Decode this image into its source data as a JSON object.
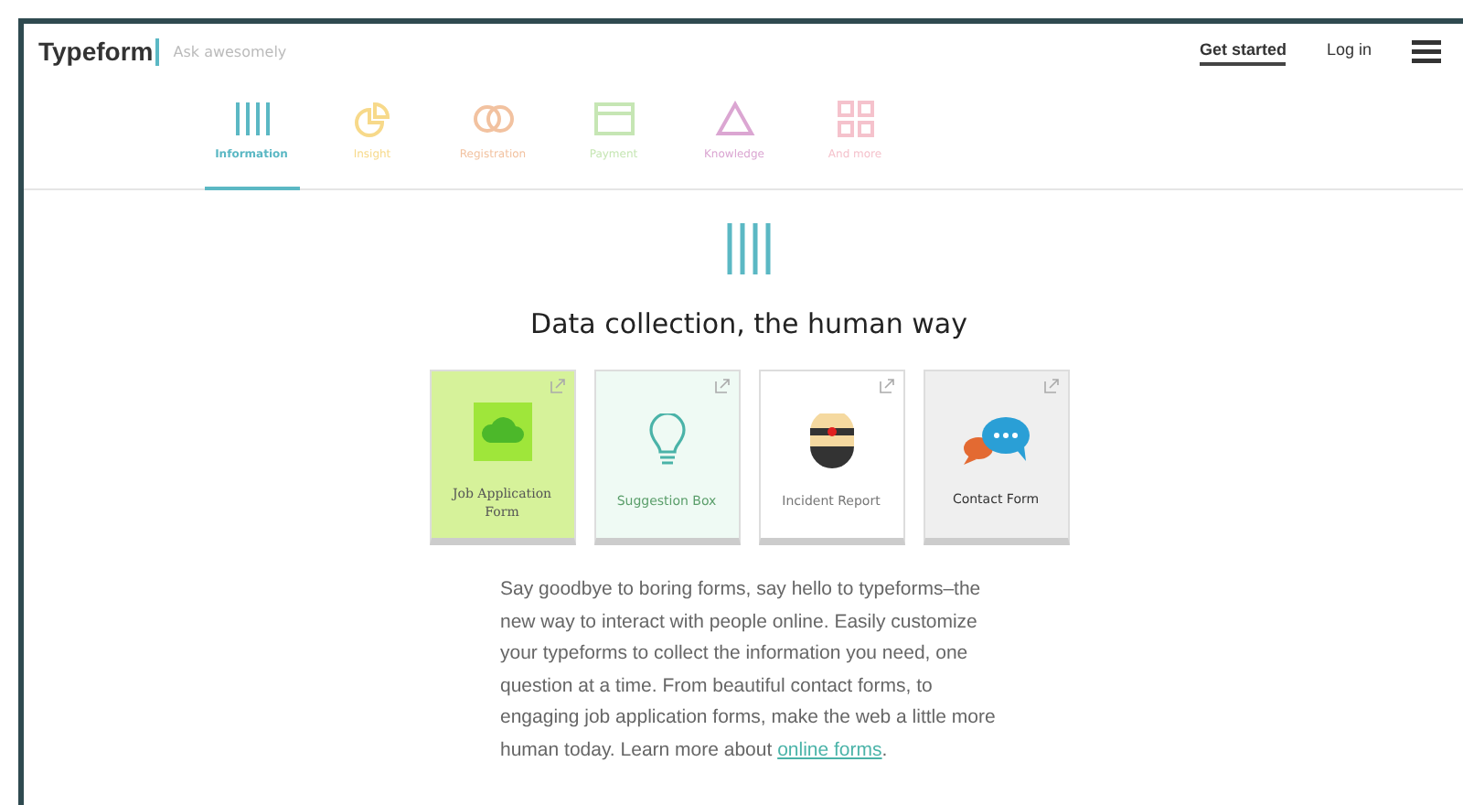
{
  "header": {
    "logo": "Typeform",
    "tagline": "Ask awesomely",
    "links": [
      {
        "label": "Get started",
        "selected": true
      },
      {
        "label": "Log in",
        "selected": false
      }
    ]
  },
  "tabs": [
    {
      "label": "Information",
      "kind": "bars",
      "color": "#5bb8c4",
      "selected": true
    },
    {
      "label": "Insight",
      "kind": "pie",
      "color": "#f7d98a",
      "selected": false
    },
    {
      "label": "Registration",
      "kind": "rings",
      "color": "#f2c2a0",
      "selected": false
    },
    {
      "label": "Payment",
      "kind": "card",
      "color": "#c6e6b4",
      "selected": false
    },
    {
      "label": "Knowledge",
      "kind": "triangle",
      "color": "#dba6d2",
      "selected": false
    },
    {
      "label": "And more",
      "kind": "grid",
      "color": "#f5c2cc",
      "selected": false
    }
  ],
  "heading": "Data collection, the human way",
  "cards": [
    {
      "title": "Job Application Form",
      "kind": "cloud"
    },
    {
      "title": "Suggestion Box",
      "kind": "bulb"
    },
    {
      "title": "Incident Report",
      "kind": "face"
    },
    {
      "title": "Contact Form",
      "kind": "chat"
    }
  ],
  "text": "Say goodbye to boring forms, say hello to typeforms–the new way to interact with people online. Easily customize your typeforms to collect the information you need, one question at a time. From beautiful contact forms, to engaging job application forms, make the web a little more human today. Learn more about ",
  "link": "online forms",
  "text_end": "."
}
